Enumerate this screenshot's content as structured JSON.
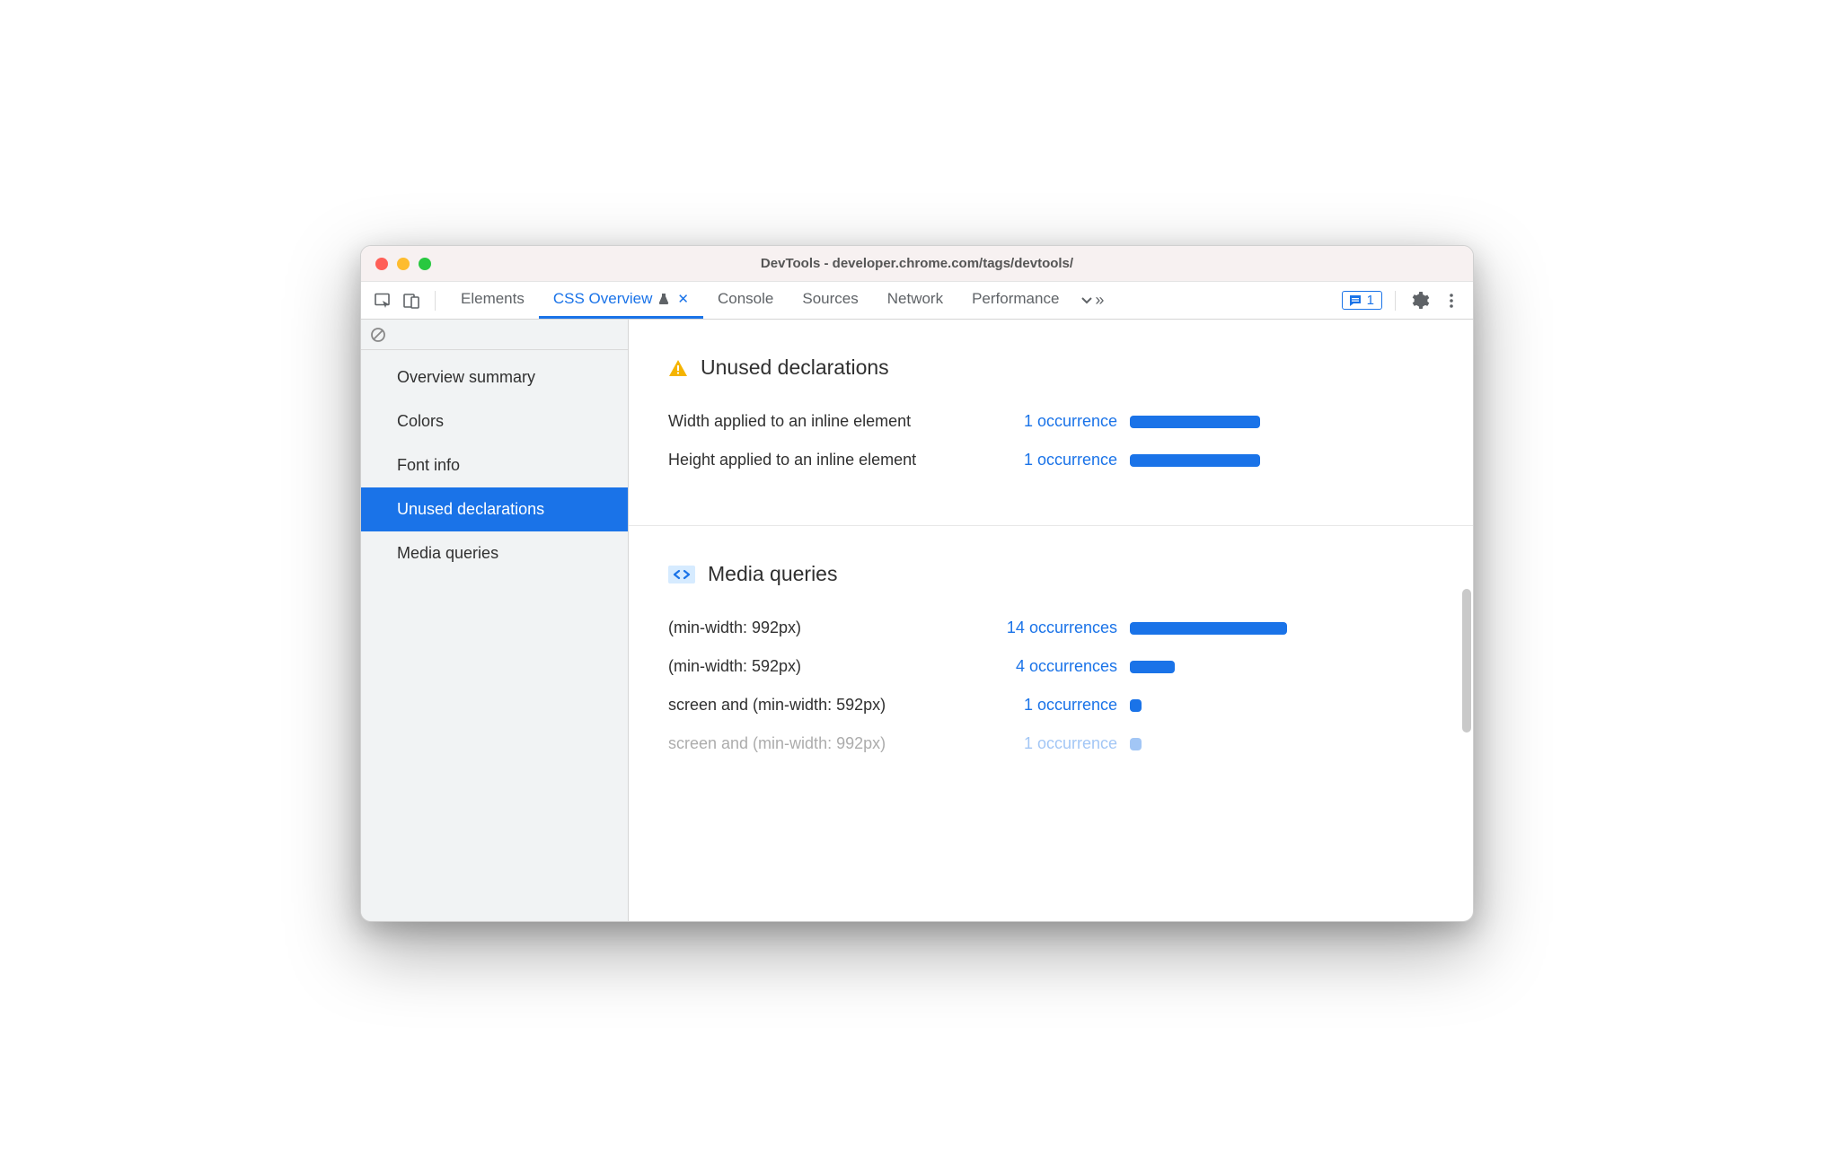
{
  "window": {
    "title": "DevTools - developer.chrome.com/tags/devtools/"
  },
  "toolbar": {
    "tabs": [
      {
        "label": "Elements"
      },
      {
        "label": "CSS Overview"
      },
      {
        "label": "Console"
      },
      {
        "label": "Sources"
      },
      {
        "label": "Network"
      },
      {
        "label": "Performance"
      }
    ],
    "feedback_count": "1"
  },
  "sidebar": {
    "items": [
      {
        "label": "Overview summary"
      },
      {
        "label": "Colors"
      },
      {
        "label": "Font info"
      },
      {
        "label": "Unused declarations"
      },
      {
        "label": "Media queries"
      }
    ]
  },
  "sections": {
    "unused": {
      "title": "Unused declarations",
      "rows": [
        {
          "label": "Width applied to an inline element",
          "link": "1 occurrence",
          "bar": 145
        },
        {
          "label": "Height applied to an inline element",
          "link": "1 occurrence",
          "bar": 145
        }
      ]
    },
    "media": {
      "title": "Media queries",
      "rows": [
        {
          "label": "(min-width: 992px)",
          "link": "14 occurrences",
          "bar": 175
        },
        {
          "label": "(min-width: 592px)",
          "link": "4 occurrences",
          "bar": 50
        },
        {
          "label": "screen and (min-width: 592px)",
          "link": "1 occurrence",
          "bar": 13
        },
        {
          "label": "screen and (min-width: 992px)",
          "link": "1 occurrence",
          "bar": 13
        }
      ]
    }
  }
}
